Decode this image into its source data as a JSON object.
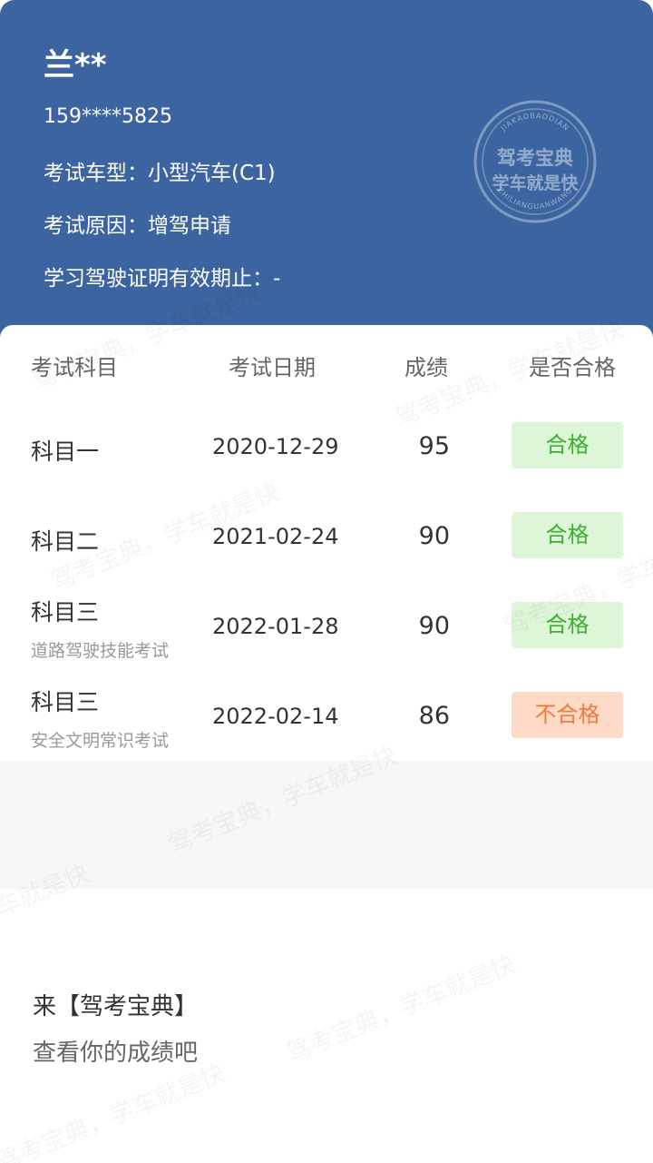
{
  "user": {
    "name": "兰**",
    "phone": "159****5825",
    "car_type": "考试车型：小型汽车(C1)",
    "reason": "考试原因：增驾申请",
    "validity": "学习驾驶证明有效期止：-"
  },
  "seal": {
    "top_arc": "JIAKAOBAODIAN",
    "line1": "驾考宝典",
    "line2": "学车就是快",
    "bottom_arc": "ZHILIANGUANWANG"
  },
  "table": {
    "headers": [
      "考试科目",
      "考试日期",
      "成绩",
      "是否合格"
    ],
    "rows": [
      {
        "subject": "科目一",
        "sub": "",
        "date": "2020-12-29",
        "score": "95",
        "result": "合格",
        "passed": true
      },
      {
        "subject": "科目二",
        "sub": "",
        "date": "2021-02-24",
        "score": "90",
        "result": "合格",
        "passed": true
      },
      {
        "subject": "科目三",
        "sub": "道路驾驶技能考试",
        "date": "2022-01-28",
        "score": "90",
        "result": "合格",
        "passed": true
      },
      {
        "subject": "科目三",
        "sub": "安全文明常识考试",
        "date": "2022-02-14",
        "score": "86",
        "result": "不合格",
        "passed": false
      }
    ]
  },
  "promo": {
    "line1": "来【驾考宝典】",
    "line2": "查看你的成绩吧"
  },
  "watermark": {
    "text": "驾考宝典，学车就是快"
  },
  "colors": {
    "header_bg": "#3c64a0",
    "pass_bg": "#def6d8",
    "pass_text": "#3fae35",
    "fail_bg": "#ffdbc7",
    "fail_text": "#f07a3c"
  }
}
